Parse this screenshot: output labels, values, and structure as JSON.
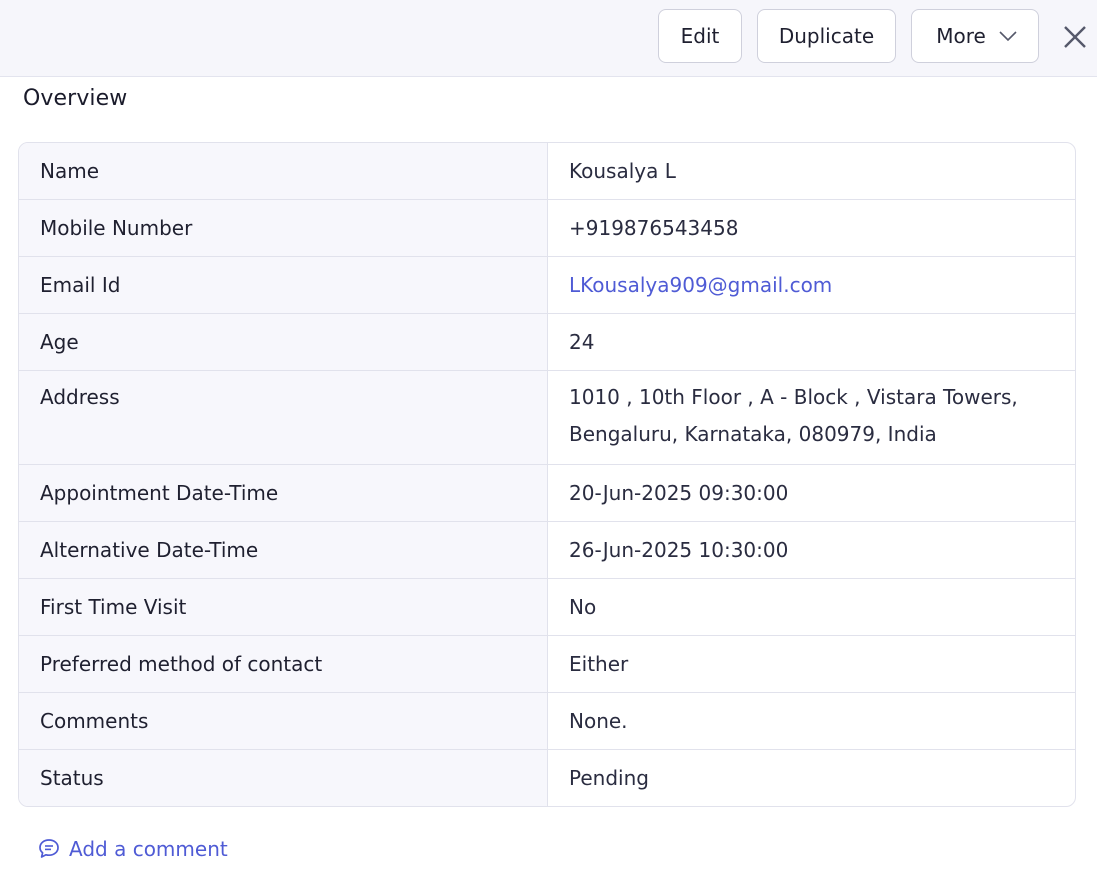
{
  "toolbar": {
    "edit_label": "Edit",
    "duplicate_label": "Duplicate",
    "more_label": "More"
  },
  "section": {
    "title": "Overview"
  },
  "fields": [
    {
      "label": "Name",
      "value": "Kousalya L"
    },
    {
      "label": "Mobile Number",
      "value": "+919876543458"
    },
    {
      "label": "Email Id",
      "value": "LKousalya909@gmail.com"
    },
    {
      "label": "Age",
      "value": "24"
    },
    {
      "label": "Address",
      "value_line1": "1010 , 10th Floor , A - Block , Vistara Towers,",
      "value_line2": "Bengaluru, Karnataka, 080979, India"
    },
    {
      "label": "Appointment Date-Time",
      "value": "20-Jun-2025 09:30:00"
    },
    {
      "label": "Alternative Date-Time",
      "value": "26-Jun-2025 10:30:00"
    },
    {
      "label": "First Time Visit",
      "value": "No"
    },
    {
      "label": "Preferred method of contact",
      "value": "Either"
    },
    {
      "label": "Comments",
      "value": "None."
    },
    {
      "label": "Status",
      "value": "Pending"
    }
  ],
  "comment": {
    "add_label": "Add a comment"
  },
  "colors": {
    "accent": "#4f5bd5",
    "header_bg": "#f6f6fb",
    "label_bg": "#f7f7fc"
  },
  "icons": [
    "chevron-down-icon",
    "close-icon",
    "comment-icon"
  ]
}
